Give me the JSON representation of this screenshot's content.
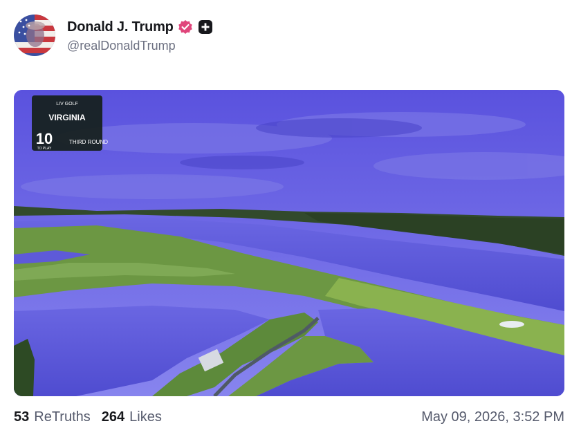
{
  "post": {
    "author": {
      "display_name": "Donald J. Trump",
      "handle": "@realDonaldTrump",
      "verified_badge_icon": "verified-badge-icon",
      "plus_icon": "plus-square-icon"
    },
    "media": {
      "scoreboard": {
        "sponsor": "LIV GOLF",
        "event": "VIRGINIA",
        "hole_number": "10",
        "to_play": "TO PLAY",
        "round": "THIRD ROUND"
      }
    },
    "stats": {
      "retruths_count": "53",
      "retruths_label": "ReTruths",
      "likes_count": "264",
      "likes_label": "Likes"
    },
    "timestamp": "May 09, 2026, 3:52 PM"
  },
  "colors": {
    "badge": "#e0457b",
    "sky": "#6a63e8",
    "water": "#5e5ad8",
    "grass": "#6f9a45"
  }
}
